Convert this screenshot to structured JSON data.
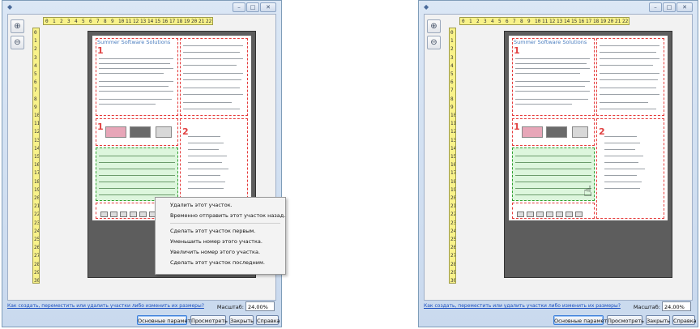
{
  "left_window": {
    "title_icon": "app-icon",
    "ruler": {
      "h_ticks": [
        "0",
        "1",
        "2",
        "3",
        "4",
        "5",
        "6",
        "7",
        "8",
        "9",
        "10",
        "11",
        "12",
        "13",
        "14",
        "15",
        "16",
        "17",
        "18",
        "19",
        "20",
        "21",
        "22"
      ],
      "v_ticks": [
        "0",
        "1",
        "2",
        "3",
        "4",
        "5",
        "6",
        "7",
        "8",
        "9",
        "10",
        "11",
        "12",
        "13",
        "14",
        "15",
        "16",
        "17",
        "18",
        "19",
        "20",
        "21",
        "22",
        "23",
        "24",
        "25",
        "26",
        "27",
        "28",
        "29",
        "30"
      ]
    },
    "document": {
      "heading": "Summer Software Solutions",
      "zone_numbers": [
        "1",
        "2",
        "1",
        "2"
      ]
    },
    "context_menu": {
      "items": [
        "Удалить этот участок.",
        "Временно отправить этот участок назад.",
        "Сделать этот участок первым.",
        "Уменьшить номер этого участка.",
        "Увеличить номер этого участка.",
        "Сделать этот участок последним."
      ]
    },
    "footer": {
      "help_link": "Как создать, переместить или удалить участки либо изменить их размеры?",
      "scale_label": "Масштаб:",
      "scale_value": "24,00%",
      "buttons": [
        "Основные параметры",
        "Просмотреть",
        "Закрыть",
        "Справка"
      ]
    }
  },
  "right_window": {
    "ruler": {
      "h_ticks": [
        "0",
        "1",
        "2",
        "3",
        "4",
        "5",
        "6",
        "7",
        "8",
        "9",
        "10",
        "11",
        "12",
        "13",
        "14",
        "15",
        "16",
        "17",
        "18",
        "19",
        "20",
        "21",
        "22"
      ],
      "v_ticks": [
        "0",
        "1",
        "2",
        "3",
        "4",
        "5",
        "6",
        "7",
        "8",
        "9",
        "10",
        "11",
        "12",
        "13",
        "14",
        "15",
        "16",
        "17",
        "18",
        "19",
        "20",
        "21",
        "22",
        "23",
        "24",
        "25",
        "26",
        "27",
        "28",
        "29",
        "30"
      ]
    },
    "document": {
      "heading": "Summer Software Solutions",
      "zone_numbers": [
        "1",
        "2",
        "1",
        "2"
      ]
    },
    "footer": {
      "help_link": "Как создать, переместить или удалить участки либо изменить их размеры?",
      "scale_label": "Масштаб:",
      "scale_value": "24,00%",
      "buttons": [
        "Основные параметры",
        "Просмотреть",
        "Закрыть",
        "Справка"
      ]
    }
  }
}
